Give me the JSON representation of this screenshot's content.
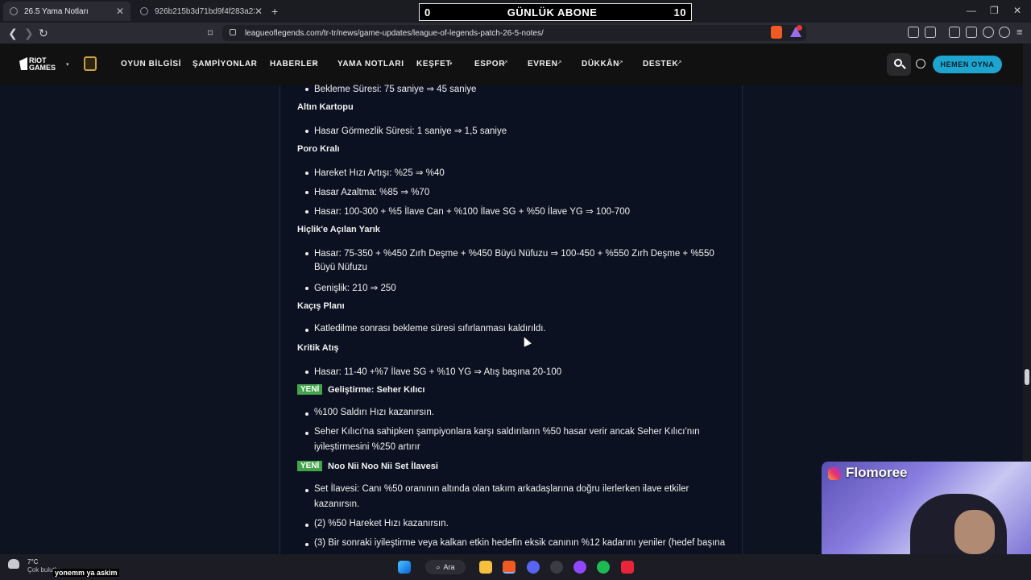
{
  "browser": {
    "tabs": [
      {
        "title": "26.5 Yama Notları",
        "active": true
      },
      {
        "title": "926b215b3d71bd9f4f283a23937617…",
        "active": false
      }
    ],
    "new_tab": "+",
    "url": "leagueoflegends.com/tr-tr/news/game-updates/league-of-legends-patch-26-5-notes/"
  },
  "overlay_counter": {
    "left": "0",
    "title": "GÜNLÜK ABONE",
    "right": "10"
  },
  "nav": {
    "brand": "RIOT GAMES",
    "items": [
      "OYUN BİLGİSİ",
      "ŞAMPİYONLAR",
      "HABERLER",
      "YAMA NOTLARI",
      "KEŞFET",
      "ESPOR",
      "EVREN",
      "DÜKKÂN",
      "DESTEK"
    ],
    "play_button": "HEMEN OYNA"
  },
  "article": {
    "top_line": "Bekleme Süresi: 75 saniye ⇒ 45 saniye",
    "sections": [
      {
        "title": "Altın Kartopu",
        "items": [
          "Hasar Görmezlik Süresi: 1 saniye ⇒ 1,5 saniye"
        ]
      },
      {
        "title": "Poro Kralı",
        "items": [
          "Hareket Hızı Artışı: %25 ⇒ %40",
          "Hasar Azaltma: %85 ⇒ %70",
          "Hasar: 100-300 + %5 İlave Can + %100 İlave SG + %50 İlave YG ⇒ 100-700"
        ]
      },
      {
        "title": "Hiçlik'e Açılan Yarık",
        "items": [
          "Hasar: 75-350 + %450 Zırh Deşme + %450 Büyü Nüfuzu ⇒ 100-450 + %550 Zırh Deşme + %550",
          "Büyü Nüfuzu",
          "Genişlik: 210 ⇒ 250"
        ]
      },
      {
        "title": "Kaçış Planı",
        "items": [
          "Katledilme sonrası bekleme süresi sıfırlanması kaldırıldı."
        ]
      },
      {
        "title": "Kritik Atış",
        "items": [
          "Hasar: 11-40 +%7 İlave SG + %10 YG ⇒ Atış başına 20-100"
        ]
      },
      {
        "badge": "YENİ",
        "title": "Geliştirme: Seher Kılıcı",
        "items": [
          "%100 Saldırı Hızı kazanırsın.",
          "Seher Kılıcı'na sahipken şampiyonlara karşı saldırıların %50 hasar verir ancak Seher Kılıcı'nın",
          "iyileştirmesini %250 artırır"
        ]
      },
      {
        "badge": "YENİ",
        "title": "Noo Nii Noo Nii Set İlavesi",
        "items": [
          "Set İlavesi: Canı %50 oranının altında olan takım arkadaşlarına doğru ilerlerken ilave etkiler",
          "kazanırsın.",
          "(2) %50 Hareket Hızı kazanırsın.",
          "(3) Bir sonraki iyileştirme veya kalkan etkin hedefin eksik canının %12 kadarını yeniler (hedef başına"
        ]
      }
    ]
  },
  "webcam": {
    "name": "Flomoree"
  },
  "taskbar": {
    "weather_temp": "7°C",
    "weather_text": "Çok bulutlu",
    "now_playing": "yonemm ya askim",
    "search": "Ara"
  },
  "colors": {
    "badge": "#45a34c",
    "play_button": "#1da4cf",
    "page_bg": "#0d1321"
  }
}
